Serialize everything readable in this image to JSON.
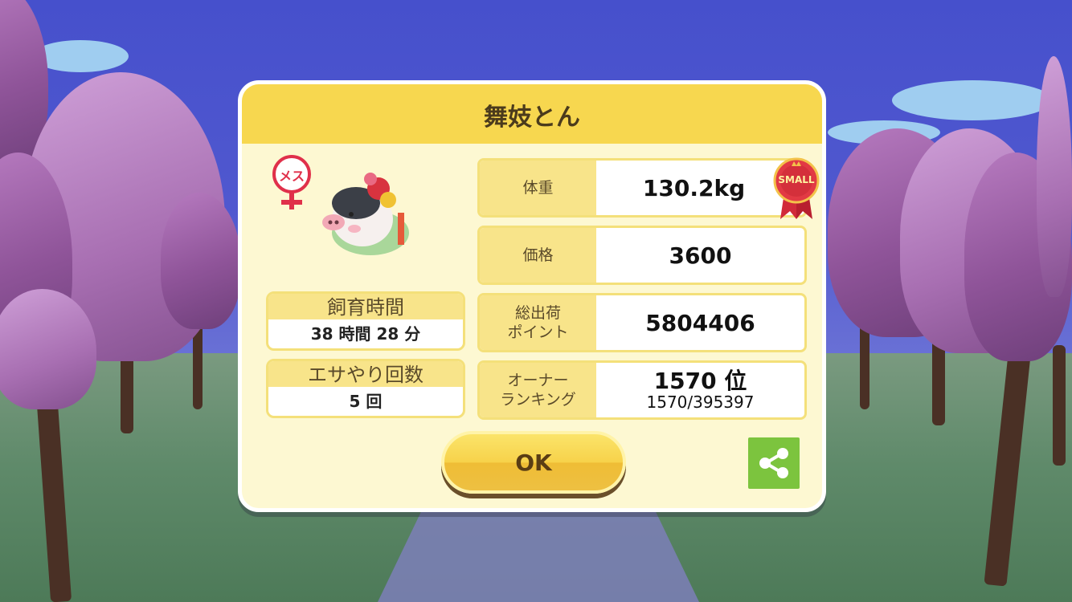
{
  "dialog": {
    "title": "舞妓とん",
    "gender_label": "メス",
    "stats": [
      {
        "label": "飼育時間",
        "value": "38 時間 28 分"
      },
      {
        "label": "エサやり回数",
        "value": "5 回"
      }
    ],
    "rows": {
      "weight": {
        "label": "体重",
        "value": "130.2kg",
        "ribbon": "SMALL"
      },
      "price": {
        "label": "価格",
        "value": "3600"
      },
      "points": {
        "label_line1": "総出荷",
        "label_line2": "ポイント",
        "value": "5804406"
      },
      "ranking": {
        "label_line1": "オーナー",
        "label_line2": "ランキング",
        "value": "1570 位",
        "sub": "1570/395397"
      }
    },
    "ok_label": "OK",
    "colors": {
      "header": "#f7d74f",
      "panel": "#fdf8d2",
      "gender": "#e0304a",
      "share": "#7cc43e"
    }
  },
  "icons": [
    "female-icon",
    "pig-character",
    "small-ribbon-icon",
    "share-icon"
  ]
}
